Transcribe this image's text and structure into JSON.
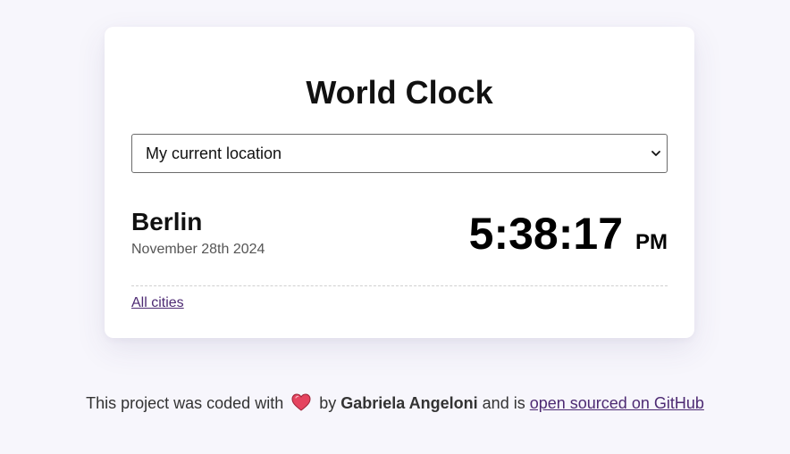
{
  "app": {
    "title": "World Clock"
  },
  "location_select": {
    "selected": "My current location"
  },
  "city_display": {
    "city": "Berlin",
    "date": "November 28th 2024",
    "time": "5:38:17",
    "period": "PM"
  },
  "links": {
    "all_cities": "All cities"
  },
  "footer": {
    "prefix": "This project was coded with",
    "by": "by",
    "author": "Gabriela Angeloni",
    "middle": "and is",
    "repo_link": "open sourced on GitHub"
  },
  "icons": {
    "heart": "heart-icon",
    "chevron": "chevron-down-icon"
  },
  "colors": {
    "background": "#f7f6fc",
    "card": "#ffffff",
    "link": "#4d2a73",
    "heart": "#e5445f"
  }
}
